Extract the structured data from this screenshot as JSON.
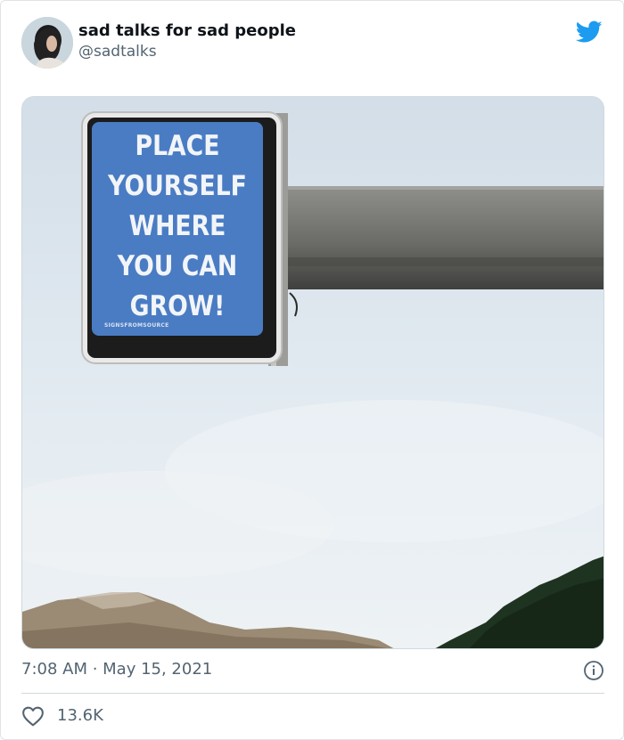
{
  "tweet": {
    "author": {
      "display_name": "sad talks for sad people",
      "handle": "@sadtalks"
    },
    "media": {
      "sign_lines": [
        "PLACE",
        "YOURSELF",
        "WHERE",
        "YOU CAN",
        "GROW!"
      ],
      "sign_credit": "SIGNSFROMSOURCE",
      "sign_color": "#4a7cc4"
    },
    "timestamp": "7:08 AM · May 15, 2021",
    "likes": "13.6K"
  },
  "colors": {
    "twitter_blue": "#1d9bf0",
    "muted_text": "#536471",
    "border": "#cfd9de"
  },
  "icons": {
    "brand": "twitter-bird-icon",
    "info": "info-icon",
    "like": "heart-icon"
  }
}
